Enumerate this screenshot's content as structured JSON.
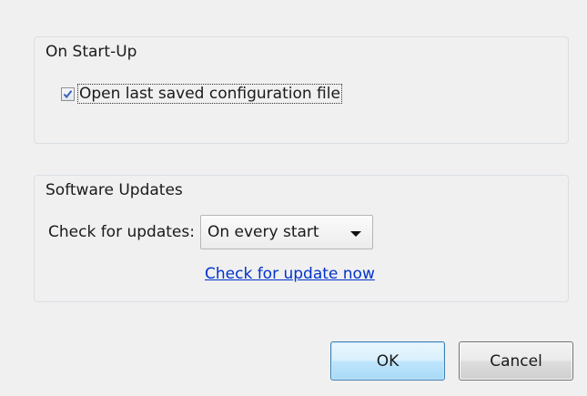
{
  "startup": {
    "title": "On Start-Up",
    "open_last_label": "Open last saved configuration file",
    "open_last_checked": true
  },
  "updates": {
    "title": "Software Updates",
    "check_label": "Check for updates:",
    "frequency_selected": "On every start",
    "check_now_link": "Check for update now"
  },
  "buttons": {
    "ok_label": "OK",
    "cancel_label": "Cancel"
  },
  "icons": {
    "checkbox_check": "checkmark-icon",
    "dropdown_arrow": "chevron-down-icon"
  },
  "colors": {
    "link": "#0033cc",
    "check": "#3a5dbd",
    "background": "#f0f0f0"
  }
}
